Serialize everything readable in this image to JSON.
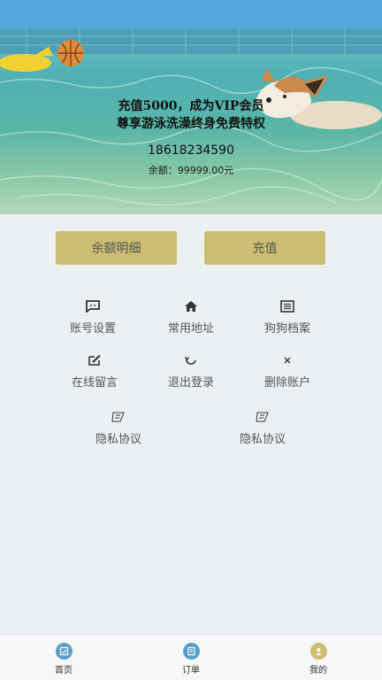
{
  "banner": {
    "promo_line1": "充值5000，成为VIP会员",
    "promo_line2": "尊享游泳洗澡终身免费特权",
    "phone": "18618234590",
    "balance": "余额：99999.00元"
  },
  "actions": {
    "detail_label": "余额明细",
    "recharge_label": "充值"
  },
  "menu": {
    "account_settings": "账号设置",
    "common_address": "常用地址",
    "dog_profile": "狗狗档案",
    "leave_message": "在线留言",
    "logout": "退出登录",
    "delete_account": "删除账户",
    "privacy1": "隐私协议",
    "privacy2": "隐私协议"
  },
  "tabbar": {
    "home": "首页",
    "orders": "订单",
    "mine": "我的"
  },
  "colors": {
    "status_bar": "#55a6dd",
    "button": "#cbbe72",
    "tab_icon": "#5a9fca",
    "tab_active": "#cbbe72"
  }
}
